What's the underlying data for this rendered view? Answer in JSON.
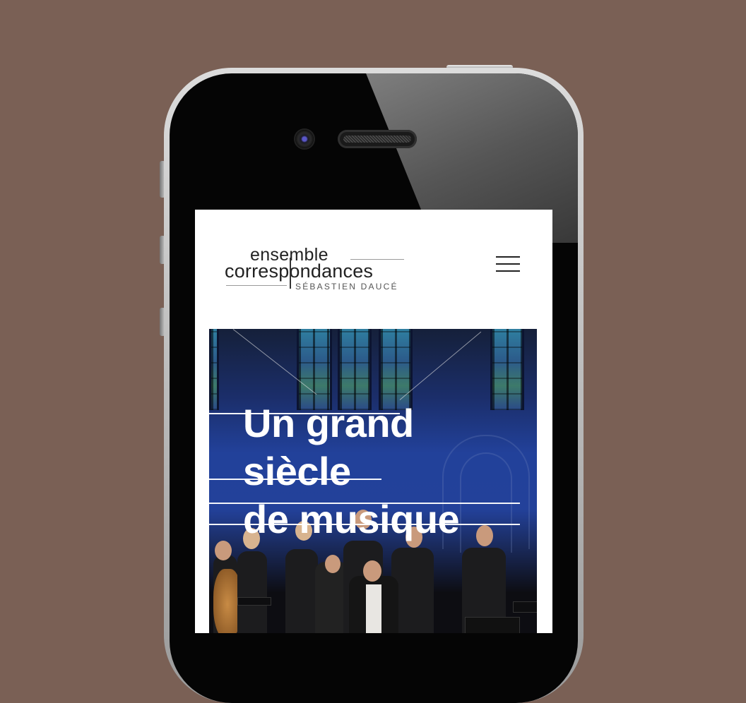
{
  "colors": {
    "background": "#7a6055",
    "hero_text": "#ffffff",
    "logo_text": "#222222"
  },
  "logo": {
    "line1": "ensemble",
    "line2": "correspondances",
    "line3": "SÉBASTIEN DAUCÉ"
  },
  "menu": {
    "icon": "hamburger-menu-icon"
  },
  "hero": {
    "title_lines": [
      "Un grand",
      "siècle",
      "de musique"
    ],
    "image": "ensemble-on-stage-photo"
  }
}
